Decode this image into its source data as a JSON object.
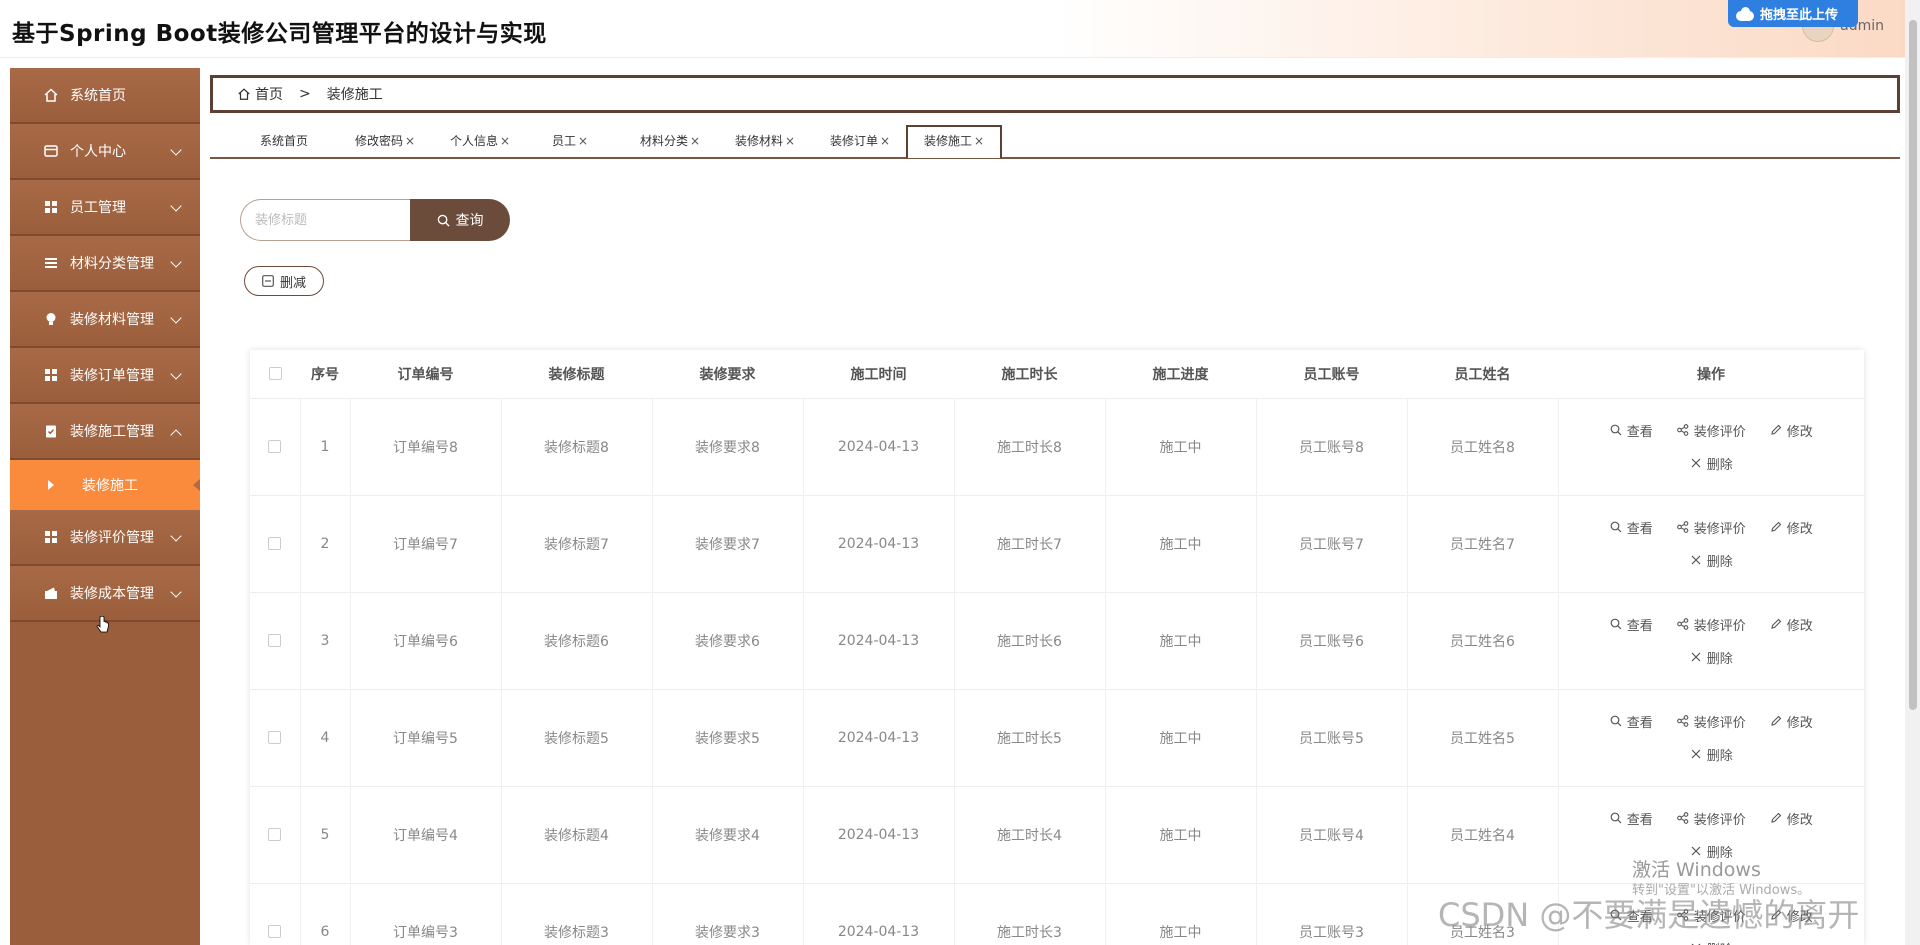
{
  "app": {
    "title": "基于Spring Boot装修公司管理平台的设计与实现",
    "user_name": "admin",
    "upload_chip": "拖拽至此上传"
  },
  "sidebar": {
    "items": [
      {
        "label": "系统首页",
        "icon": "home-icon",
        "expandable": false
      },
      {
        "label": "个人中心",
        "icon": "wallet-icon",
        "expandable": true
      },
      {
        "label": "员工管理",
        "icon": "grid-icon",
        "expandable": true
      },
      {
        "label": "材料分类管理",
        "icon": "list-icon",
        "expandable": true
      },
      {
        "label": "装修材料管理",
        "icon": "bulb-icon",
        "expandable": true
      },
      {
        "label": "装修订单管理",
        "icon": "grid-icon",
        "expandable": true
      },
      {
        "label": "装修施工管理",
        "icon": "clipboard-icon",
        "expandable": true,
        "expanded": true
      },
      {
        "label": "装修评价管理",
        "icon": "grid-icon",
        "expandable": true
      },
      {
        "label": "装修成本管理",
        "icon": "wallet-icon",
        "expandable": true
      }
    ],
    "active_sub": "装修施工"
  },
  "breadcrumb": {
    "home": "首页",
    "separator": ">",
    "current": "装修施工"
  },
  "tabs": [
    {
      "label": "系统首页",
      "closable": false
    },
    {
      "label": "修改密码",
      "closable": true
    },
    {
      "label": "个人信息",
      "closable": true
    },
    {
      "label": "员工",
      "closable": true
    },
    {
      "label": "材料分类",
      "closable": true
    },
    {
      "label": "装修材料",
      "closable": true
    },
    {
      "label": "装修订单",
      "closable": true
    },
    {
      "label": "装修施工",
      "closable": true,
      "active": true
    }
  ],
  "tab_close": "×",
  "search": {
    "placeholder": "装修标题",
    "button": "查询"
  },
  "toolbar": {
    "delete_label": "删减"
  },
  "table": {
    "headers": [
      "序号",
      "订单编号",
      "装修标题",
      "装修要求",
      "施工时间",
      "施工时长",
      "施工进度",
      "员工账号",
      "员工姓名",
      "操作"
    ],
    "rows": [
      [
        "1",
        "订单编号8",
        "装修标题8",
        "装修要求8",
        "2024-04-13",
        "施工时长8",
        "施工中",
        "员工账号8",
        "员工姓名8"
      ],
      [
        "2",
        "订单编号7",
        "装修标题7",
        "装修要求7",
        "2024-04-13",
        "施工时长7",
        "施工中",
        "员工账号7",
        "员工姓名7"
      ],
      [
        "3",
        "订单编号6",
        "装修标题6",
        "装修要求6",
        "2024-04-13",
        "施工时长6",
        "施工中",
        "员工账号6",
        "员工姓名6"
      ],
      [
        "4",
        "订单编号5",
        "装修标题5",
        "装修要求5",
        "2024-04-13",
        "施工时长5",
        "施工中",
        "员工账号5",
        "员工姓名5"
      ],
      [
        "5",
        "订单编号4",
        "装修标题4",
        "装修要求4",
        "2024-04-13",
        "施工时长4",
        "施工中",
        "员工账号4",
        "员工姓名4"
      ],
      [
        "6",
        "订单编号3",
        "装修标题3",
        "装修要求3",
        "2024-04-13",
        "施工时长3",
        "施工中",
        "员工账号3",
        "员工姓名3"
      ]
    ],
    "actions": {
      "view": "查看",
      "review": "装修评价",
      "edit": "修改",
      "delete": "删除"
    }
  },
  "watermark": {
    "windows_line1": "激活 Windows",
    "windows_line2": "转到\"设置\"以激活 Windows。",
    "csdn": "CSDN @不要满是遗憾的离开"
  },
  "colors": {
    "sidebar_bg": "#9b5e3c",
    "active_sub_bg": "#fa8b3c",
    "accent_dark": "#6b4c3b",
    "breadcrumb_border": "#5c4033"
  }
}
